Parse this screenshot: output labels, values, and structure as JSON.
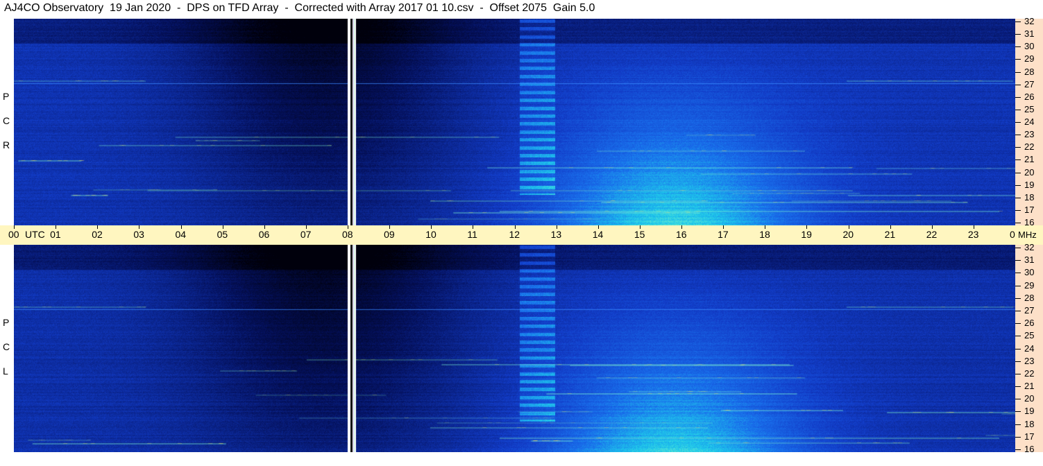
{
  "header": {
    "title": "AJ4CO Observatory  19 Jan 2020  -  DPS on TFD Array  -  Corrected with Array 2017 01 10.csv  -  Offset 2075  Gain 5.0"
  },
  "chart_data": {
    "type": "heatmap",
    "title": "AJ4CO Observatory  19 Jan 2020  -  DPS on TFD Array  -  Corrected with Array 2017 01 10.csv  -  Offset 2075  Gain 5.0",
    "x_unit_label": "UTC",
    "y_unit_label": "MHz",
    "x_range": [
      0,
      24
    ],
    "y_range": [
      16,
      32
    ],
    "x_ticks": [
      "00",
      "01",
      "02",
      "03",
      "04",
      "05",
      "06",
      "07",
      "08",
      "09",
      "10",
      "11",
      "12",
      "13",
      "14",
      "15",
      "16",
      "17",
      "18",
      "19",
      "20",
      "21",
      "22",
      "23",
      "00"
    ],
    "y_ticks": [
      "32",
      "31",
      "30",
      "29",
      "28",
      "27",
      "26",
      "25",
      "24",
      "23",
      "22",
      "21",
      "20",
      "19",
      "18",
      "17",
      "16"
    ],
    "panels": [
      {
        "name": "RCP",
        "label_letters": [
          "P",
          "C",
          "R"
        ]
      },
      {
        "name": "LCP",
        "label_letters": [
          "P",
          "C",
          "L"
        ]
      }
    ],
    "data_gap_utc": 8.0,
    "colors": {
      "low": "#000010",
      "mid": "#1446e6",
      "high": "#20e0e8",
      "peak": "#ffff60"
    }
  }
}
